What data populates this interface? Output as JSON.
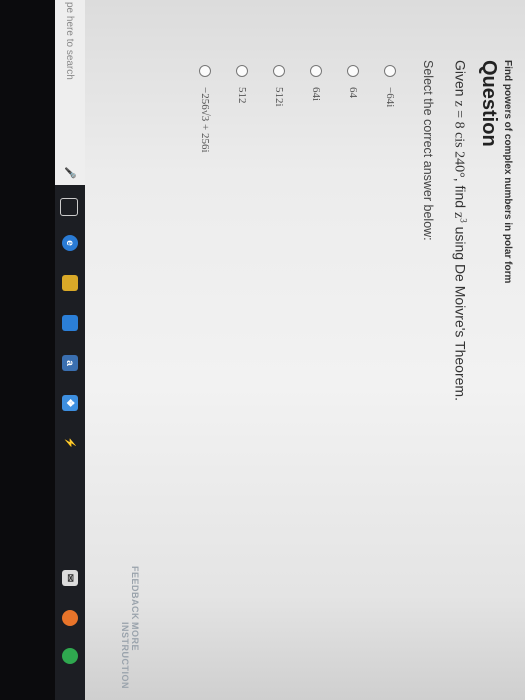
{
  "breadcrumb": "Find powers of complex numbers in polar form",
  "question_heading": "Question",
  "question": {
    "prefix": "Given ",
    "z_expr": "z = 8 cis 240°",
    "mid": ", find ",
    "z3": "z",
    "exp": "3",
    "suffix": " using De Moivre's Theorem."
  },
  "instruction": "Select the correct answer below:",
  "choices": [
    "−64i",
    "64",
    "64i",
    "512i",
    "512",
    "−256√3 + 256i"
  ],
  "links": {
    "feedback": "FEEDBACK",
    "more_instruction": "MORE INSTRUCTION"
  },
  "taskbar": {
    "search_placeholder": "pe here to search",
    "icons": [
      "mic-icon",
      "task-view-icon",
      "edge-icon",
      "file-explorer-icon",
      "store-icon",
      "amazon-icon",
      "dropbox-icon",
      "winamp-icon",
      "mail-icon",
      "firefox-icon",
      "chrome-icon"
    ]
  },
  "colors": {
    "radio_border": "#777777",
    "taskbar": "#1c1e23",
    "edge": "#2a7bd4",
    "explorer": "#d9a928",
    "store": "#2b7fd8",
    "amazon": "#3a6fb0",
    "dropbox": "#3d8fe0"
  }
}
